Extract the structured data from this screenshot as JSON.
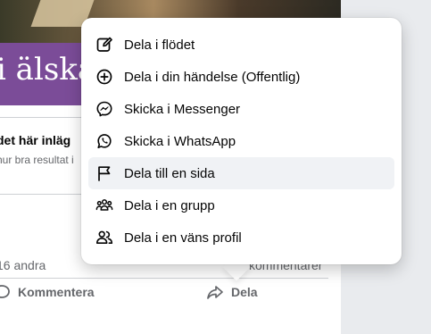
{
  "banner": {
    "text": "i älskar"
  },
  "post": {
    "title": "det här inläg",
    "subtitle": "hur bra resultat i"
  },
  "footer": {
    "likes_text": "16 andra",
    "comments_text": "kommentarer",
    "comment_label": "Kommentera",
    "share_label": "Dela"
  },
  "share_menu": {
    "items": [
      {
        "label": "Dela i flödet",
        "icon": "edit-icon"
      },
      {
        "label": "Dela i din händelse (Offentlig)",
        "icon": "add-circle-icon"
      },
      {
        "label": "Skicka i Messenger",
        "icon": "messenger-icon"
      },
      {
        "label": "Skicka i WhatsApp",
        "icon": "whatsapp-icon"
      },
      {
        "label": "Dela till en sida",
        "icon": "flag-icon"
      },
      {
        "label": "Dela i en grupp",
        "icon": "group-icon"
      },
      {
        "label": "Dela i en väns profil",
        "icon": "friend-profile-icon"
      }
    ]
  }
}
